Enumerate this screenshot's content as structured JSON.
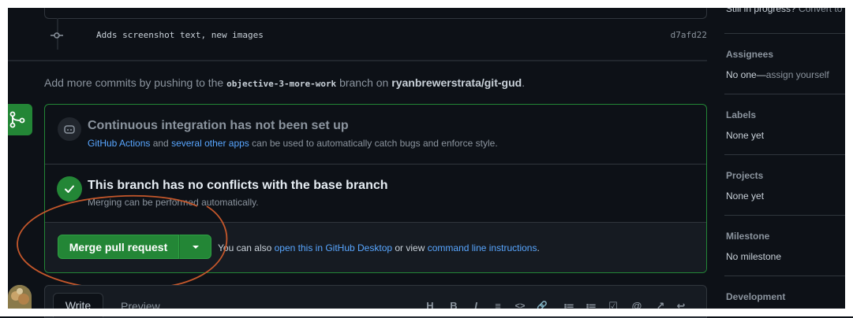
{
  "timeline": {
    "commit": {
      "message": "Adds screenshot text, new images",
      "sha": "d7afd22"
    },
    "push_hint": {
      "prefix": "Add more commits by pushing to the ",
      "branch": "objective-3-more-work",
      "middle": " branch on ",
      "repo": "ryanbrewerstrata/git-gud",
      "suffix": "."
    }
  },
  "merge_box": {
    "ci": {
      "title": "Continuous integration has not been set up",
      "link1": "GitHub Actions",
      "text1": " and ",
      "link2": "several other apps",
      "text2": " can be used to automatically catch bugs and enforce style."
    },
    "conflicts": {
      "title": "This branch has no conflicts with the base branch",
      "desc": "Merging can be performed automatically."
    },
    "merge": {
      "button_label": "Merge pull request",
      "hint_prefix": "You can also ",
      "link_desktop": "open this in GitHub Desktop",
      "hint_middle": " or view ",
      "link_cli": "command line instructions",
      "hint_suffix": "."
    }
  },
  "comment": {
    "tab_write": "Write",
    "tab_preview": "Preview",
    "toolbar": [
      "H",
      "B",
      "I",
      "≡",
      "<>",
      "🔗",
      "≔",
      "≔",
      "☑",
      "@",
      "↗",
      "↩"
    ]
  },
  "sidebar": {
    "draft_status": "Still in progress?",
    "draft_link": " Convert to draft",
    "sections": [
      {
        "heading": "Assignees",
        "value": "No one—",
        "value_muted": "assign yourself"
      },
      {
        "heading": "Labels",
        "value": "None yet",
        "value_muted": ""
      },
      {
        "heading": "Projects",
        "value": "None yet",
        "value_muted": ""
      },
      {
        "heading": "Milestone",
        "value": "No milestone",
        "value_muted": ""
      },
      {
        "heading": "Development",
        "value": "",
        "value_muted": ""
      }
    ]
  },
  "colors": {
    "background": "#0d1117",
    "accent_green": "#238636",
    "link_blue": "#58a6ff",
    "annotation_red": "#c4572b"
  }
}
